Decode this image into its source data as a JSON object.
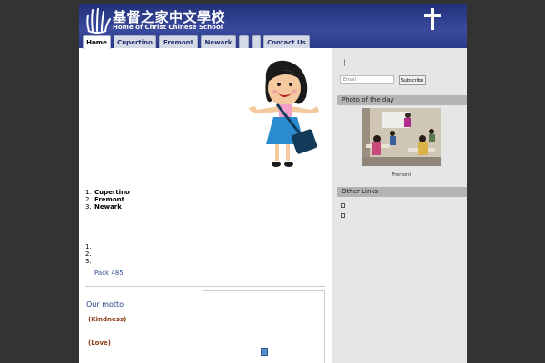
{
  "header": {
    "title_cn": "基督之家中文學校",
    "title_en": "Home of Christ Chinese School"
  },
  "nav": {
    "tabs": [
      {
        "label": "Home",
        "active": true
      },
      {
        "label": "Cupertino"
      },
      {
        "label": "Fremont"
      },
      {
        "label": "Newark"
      },
      {
        "label": ""
      },
      {
        "label": ""
      },
      {
        "label": "Contact Us"
      }
    ]
  },
  "main": {
    "list1": [
      {
        "num": "1.",
        "text": "Cupertino"
      },
      {
        "num": "2.",
        "text": "Fremont"
      },
      {
        "num": "3.",
        "text": "Newark"
      }
    ],
    "list2": [
      {
        "num": "1.",
        "text": ""
      },
      {
        "num": "2.",
        "text": ""
      },
      {
        "num": "3.",
        "text": ""
      }
    ],
    "pack_link": "Pack 485",
    "motto": {
      "title": "Our motto",
      "items": [
        "(Kindness)",
        "(Love)"
      ]
    }
  },
  "sidebar": {
    "top_text": ". |",
    "email_placeholder": "Email",
    "subscribe_label": "Subscribe",
    "photo_heading": "Photo of the day",
    "photo_caption": "Fremont",
    "links_heading": "Other Links",
    "links": [
      "",
      ""
    ]
  },
  "colors": {
    "header_bg": "#2b3a88",
    "page_bg": "#333333",
    "sidebar_bg": "#e6e6e6",
    "motto_text": "#8b3a12"
  }
}
